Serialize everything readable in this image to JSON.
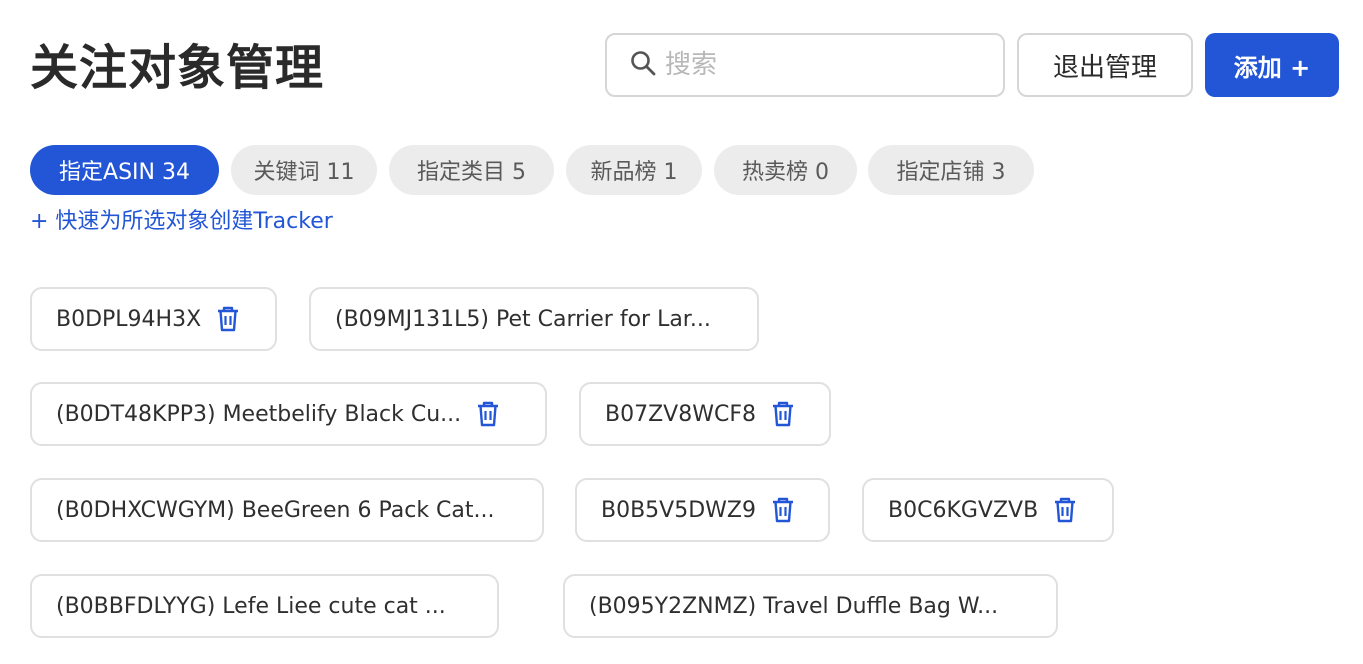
{
  "header": {
    "title": "关注对象管理",
    "search_placeholder": "搜索",
    "search_value": "",
    "exit_label": "退出管理",
    "add_label": "添加 +"
  },
  "tabs": [
    {
      "label": "指定ASIN 34",
      "active": true
    },
    {
      "label": "关键词 11",
      "active": false
    },
    {
      "label": "指定类目 5",
      "active": false
    },
    {
      "label": "新品榜 1",
      "active": false
    },
    {
      "label": "热卖榜 0",
      "active": false
    },
    {
      "label": "指定店铺 3",
      "active": false
    }
  ],
  "quick_link": "+ 快速为所选对象创建Tracker",
  "items": [
    {
      "label": "B0DPL94H3X"
    },
    {
      "label": "(B09MJ131L5) Pet Carrier for Lar..."
    },
    {
      "label": "(B0DT48KPP3) Meetbelify Black Cu..."
    },
    {
      "label": "B07ZV8WCF8"
    },
    {
      "label": "(B0DHXCWGYM) BeeGreen 6 Pack Cat..."
    },
    {
      "label": "B0B5V5DWZ9"
    },
    {
      "label": "B0C6KGVZVB"
    },
    {
      "label": "(B0BBFDLYYG) Lefe Liee cute cat ..."
    },
    {
      "label": "(B095Y2ZNMZ) Travel Duffle Bag W..."
    }
  ],
  "colors": {
    "accent": "#2356d6",
    "tab_inactive_bg": "#ececec",
    "border": "#e0e0e0"
  },
  "icons": {
    "search": "search-icon",
    "delete": "trash-icon"
  }
}
